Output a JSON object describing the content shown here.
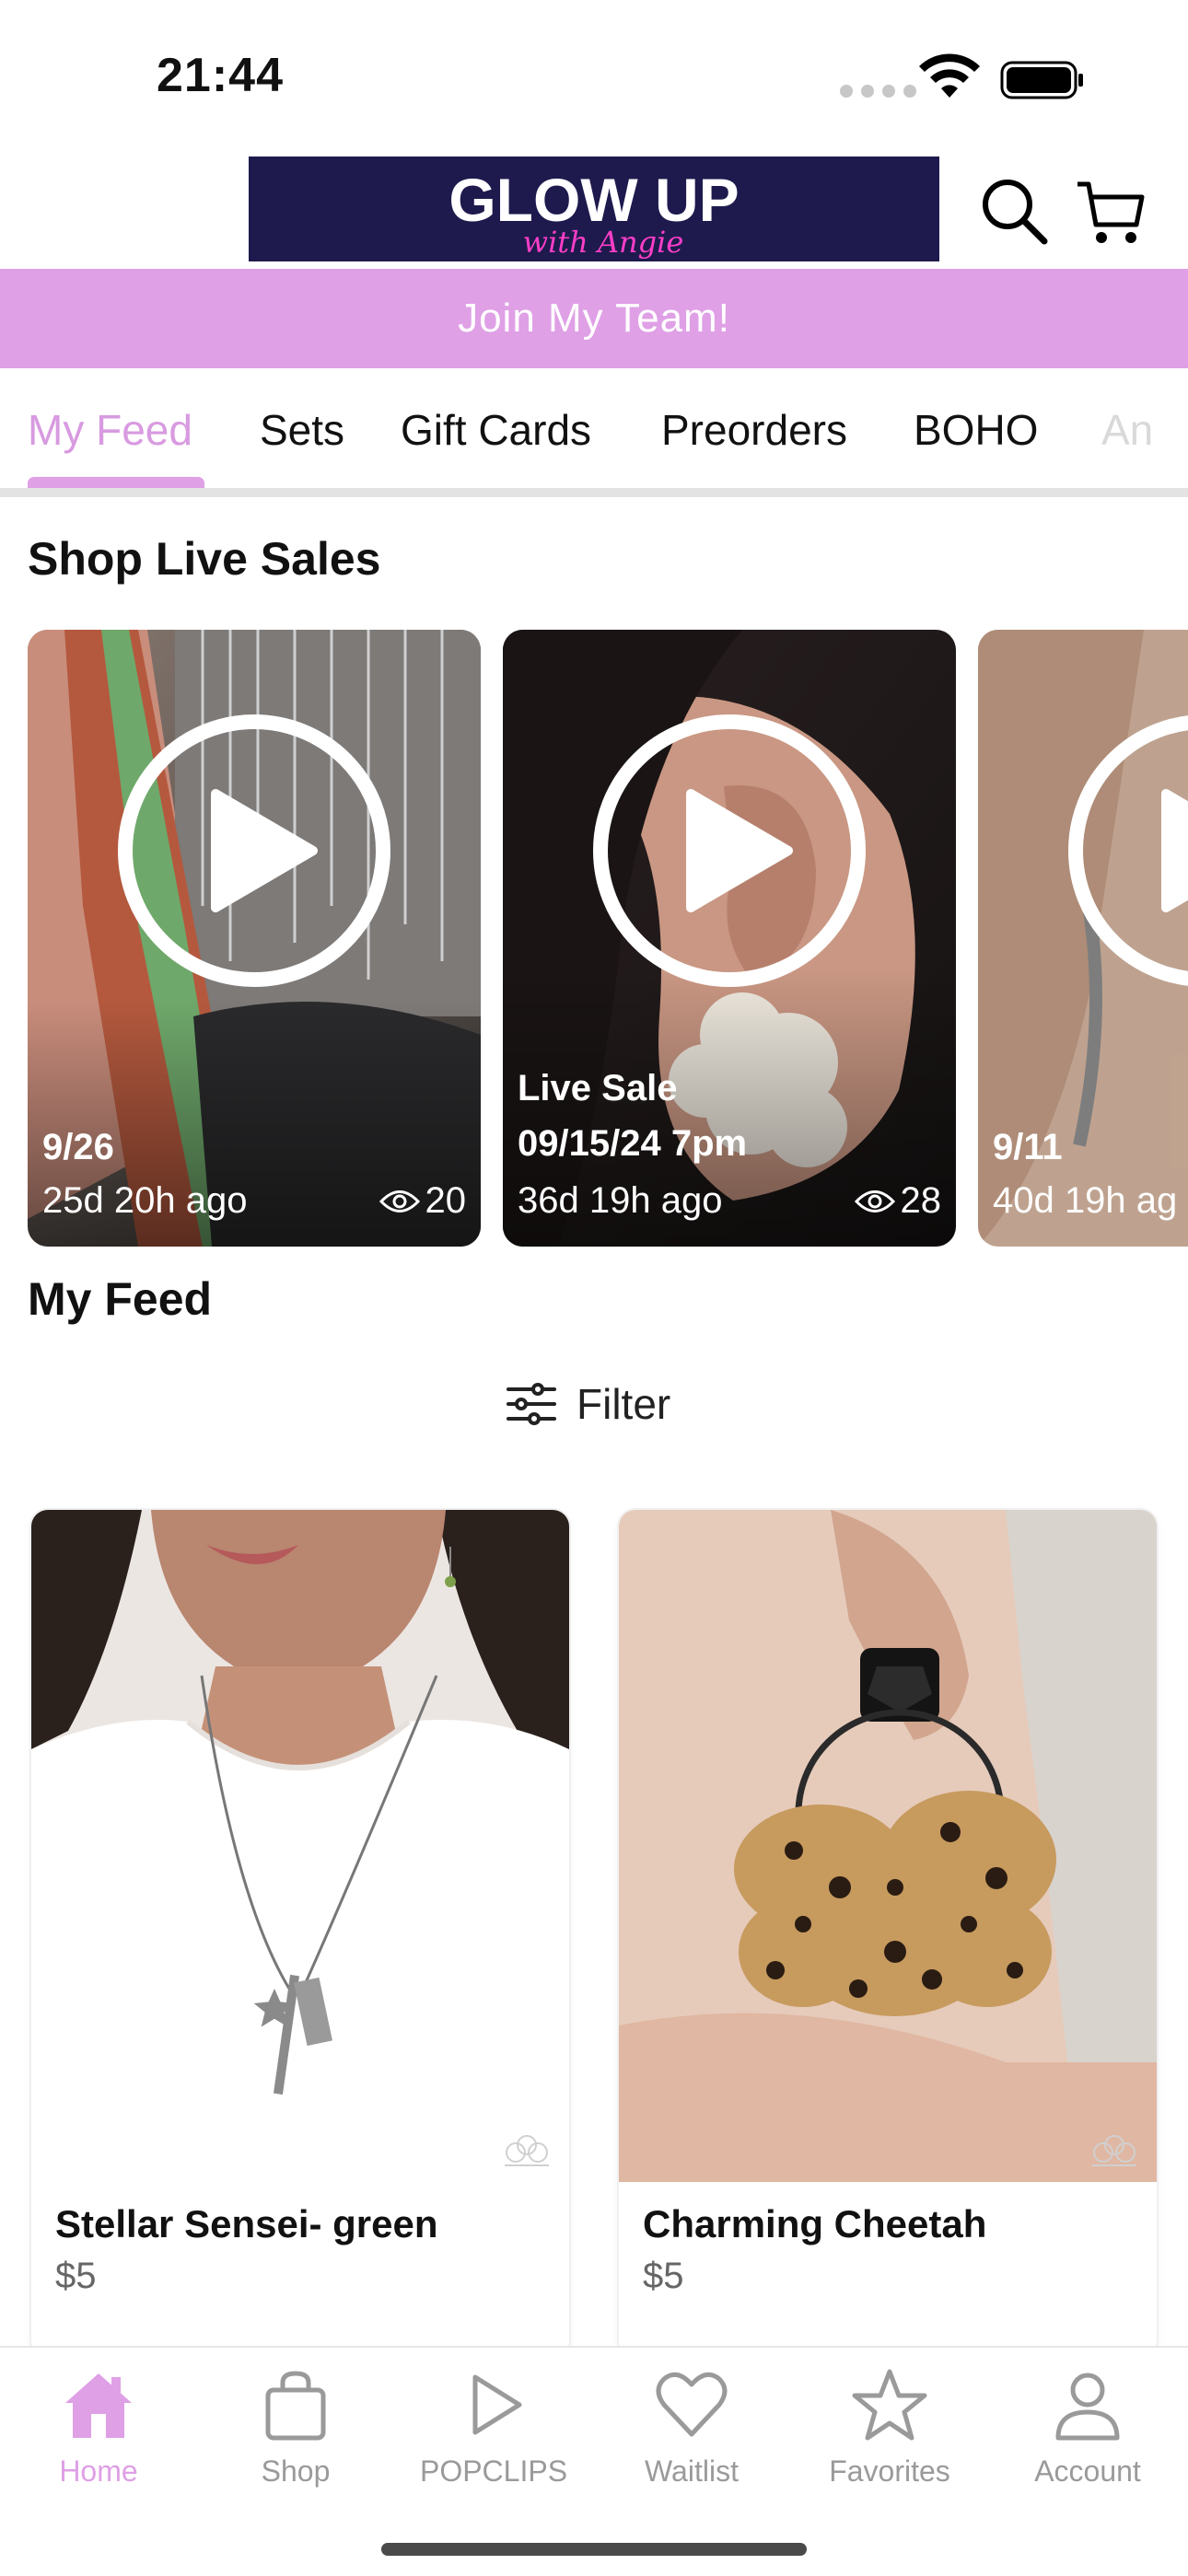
{
  "status_bar": {
    "time": "21:44"
  },
  "header": {
    "logo_text": "GLOW UP",
    "logo_script": "with Angie"
  },
  "banner": {
    "label": "Join My Team!"
  },
  "tabs": [
    {
      "label": "My Feed",
      "active": true
    },
    {
      "label": "Sets"
    },
    {
      "label": "Gift Cards"
    },
    {
      "label": "Preorders"
    },
    {
      "label": "BOHO"
    },
    {
      "label": "An"
    }
  ],
  "live_sales": {
    "title": "Shop Live Sales",
    "cards": [
      {
        "title_line1": "",
        "title_line2": "9/26",
        "ago": "25d 20h ago",
        "views": "20"
      },
      {
        "title_line1": "Live Sale",
        "title_line2": "09/15/24 7pm",
        "ago": "36d 19h ago",
        "views": "28"
      },
      {
        "title_line1": "",
        "title_line2": "9/11",
        "ago": "40d 19h ag",
        "views": ""
      }
    ]
  },
  "feed": {
    "title": "My Feed",
    "filter_label": "Filter",
    "products": [
      {
        "name": "Stellar Sensei- green",
        "price": "$5"
      },
      {
        "name": "Charming Cheetah",
        "price": "$5"
      }
    ]
  },
  "bottom_nav": [
    {
      "label": "Home",
      "icon": "home-icon",
      "active": true
    },
    {
      "label": "Shop",
      "icon": "bag-icon"
    },
    {
      "label": "POPCLIPS",
      "icon": "play-icon"
    },
    {
      "label": "Waitlist",
      "icon": "heart-icon"
    },
    {
      "label": "Favorites",
      "icon": "star-icon"
    },
    {
      "label": "Account",
      "icon": "person-icon"
    }
  ],
  "colors": {
    "accent": "#dfa0e6",
    "accent_text": "#d89ae0",
    "logo_bg": "#1e1a4d"
  }
}
